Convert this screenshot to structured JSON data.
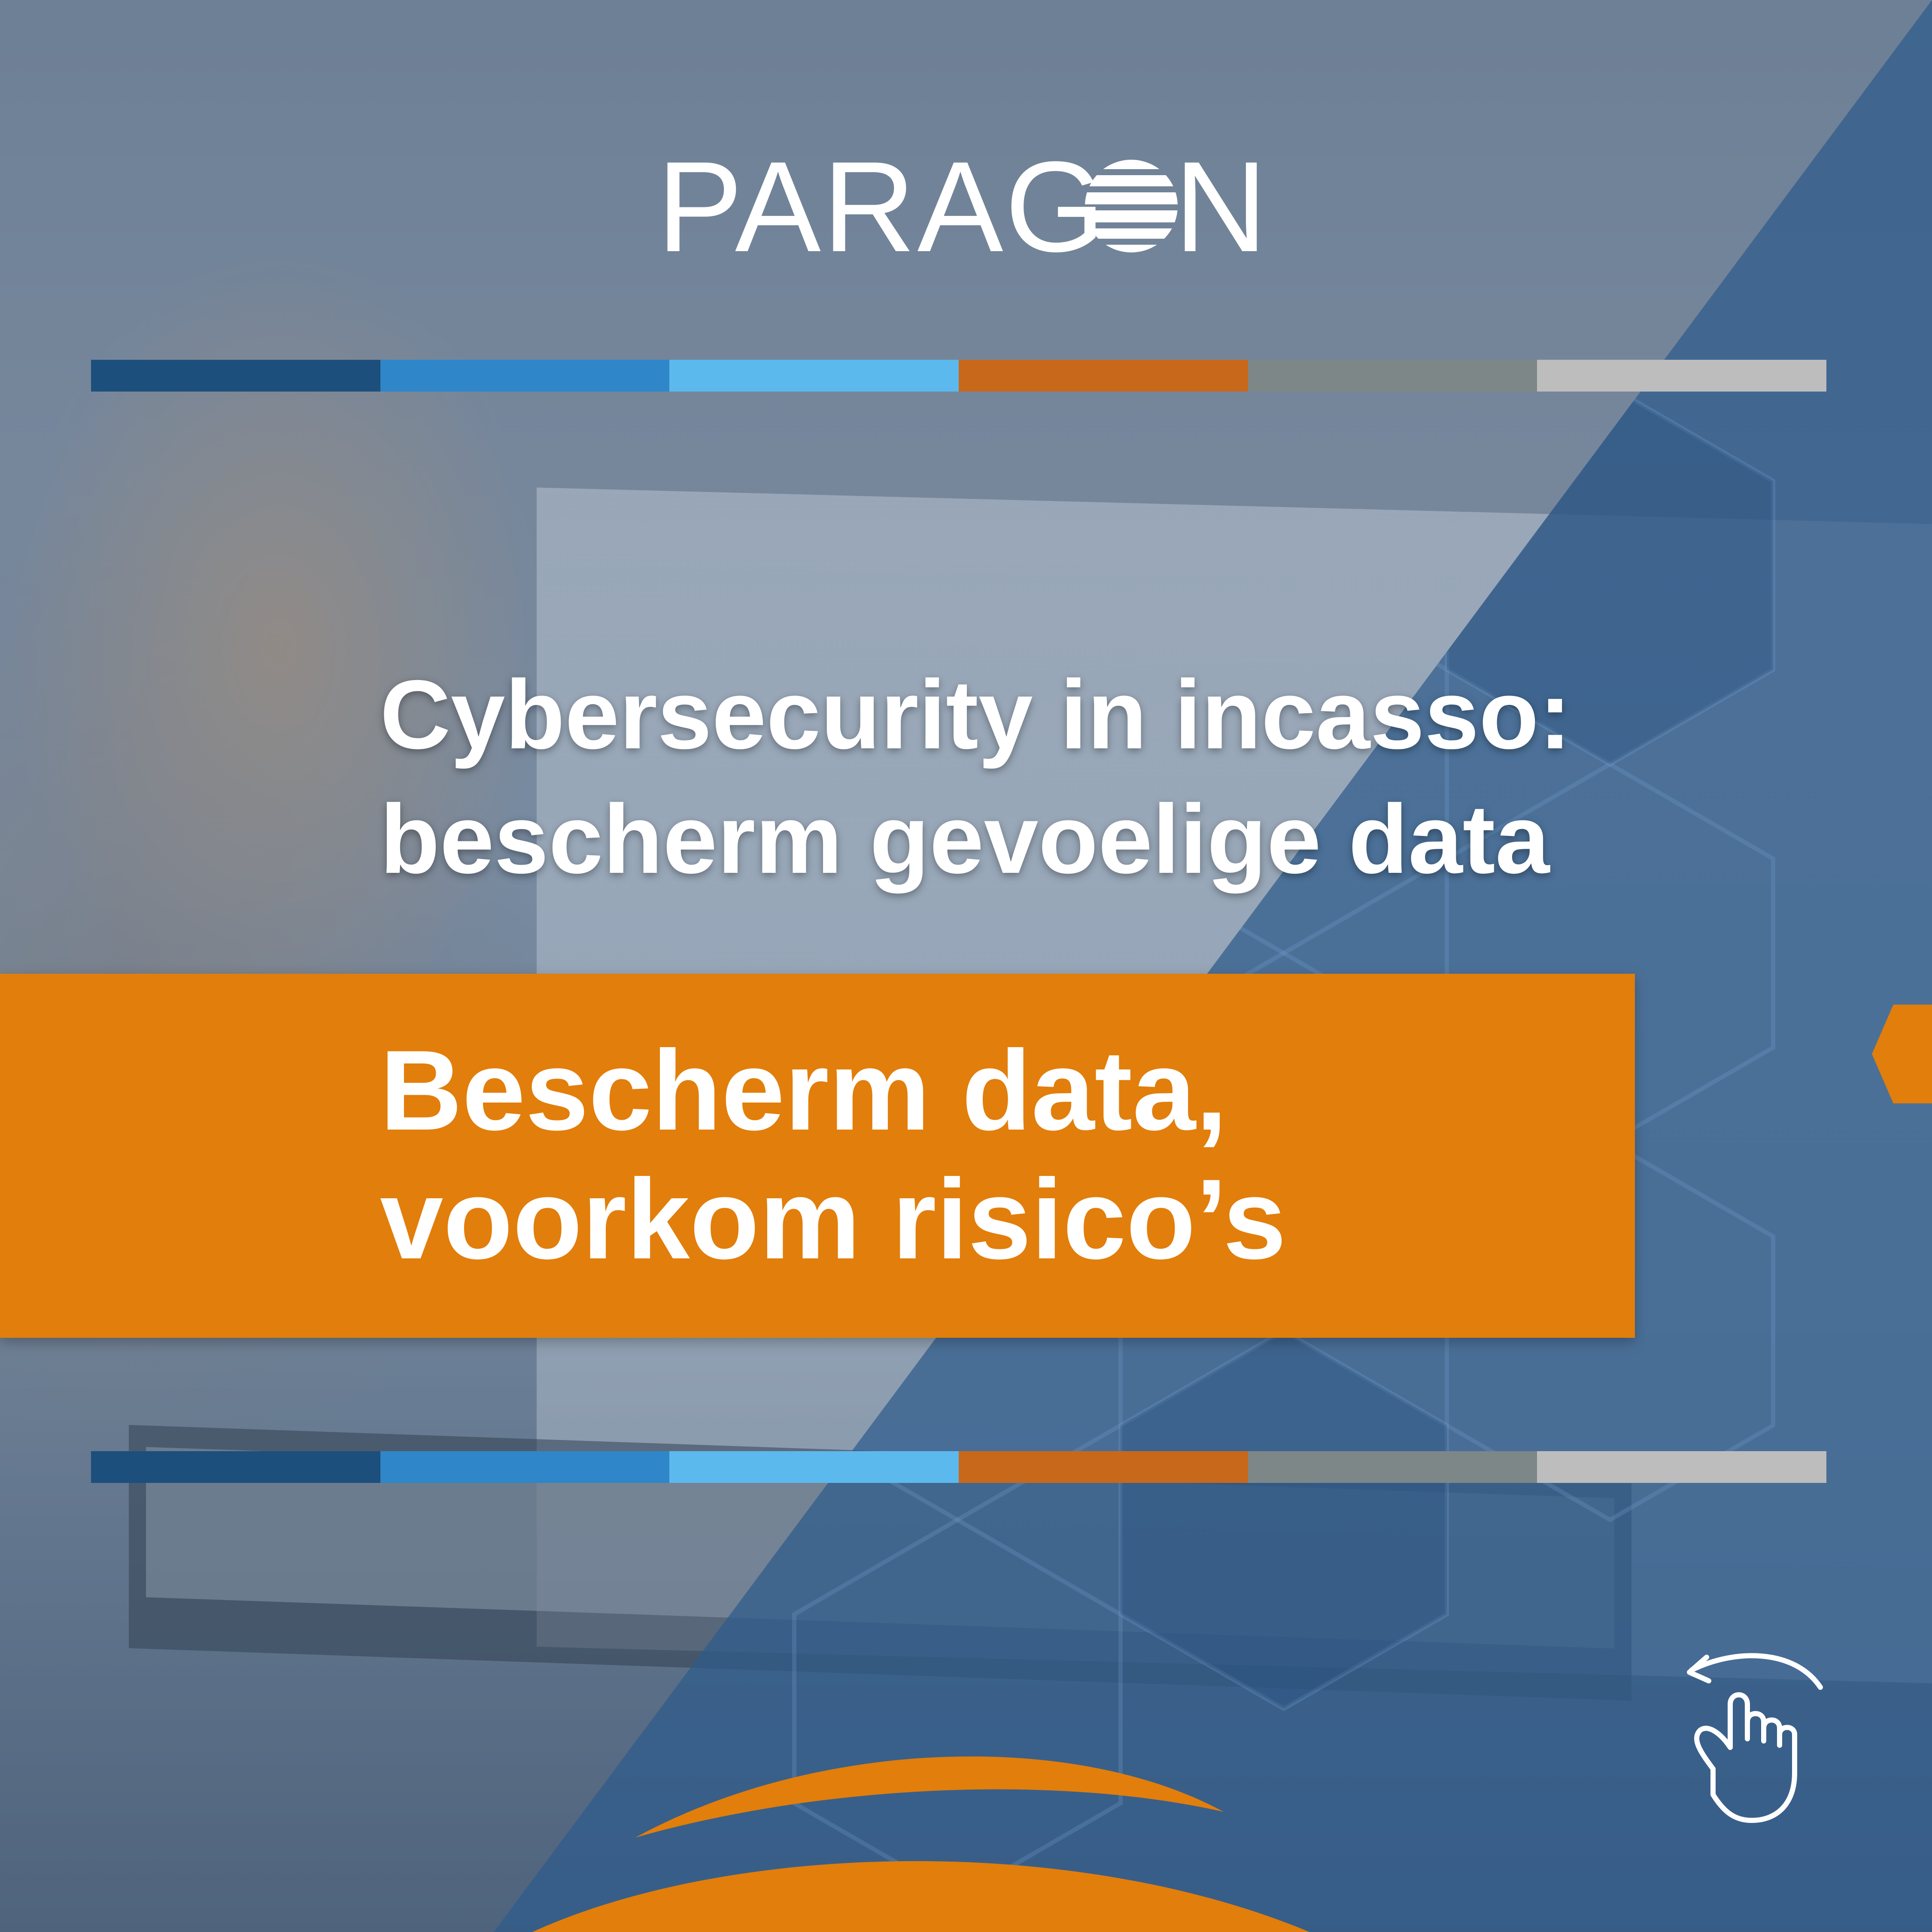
{
  "brand": {
    "logo_text": "PARAGON",
    "logo_icon": "paragon-globe-icon"
  },
  "headline": {
    "line1": "Cybersecurity in incasso:",
    "line2": "bescherm gevoelige data"
  },
  "banner": {
    "line1": "Bescherm data,",
    "line2": "voorkom risico’s"
  },
  "colors": {
    "accent_orange": "#e27e0b",
    "blue_overlay": "#2e5c8c",
    "stripe": [
      "#1d4f7d",
      "#2f86c8",
      "#5bb9ee",
      "#c8681b",
      "#7d8788",
      "#bdbdbd"
    ]
  },
  "icons": {
    "swipe": "swipe-hand-icon"
  }
}
